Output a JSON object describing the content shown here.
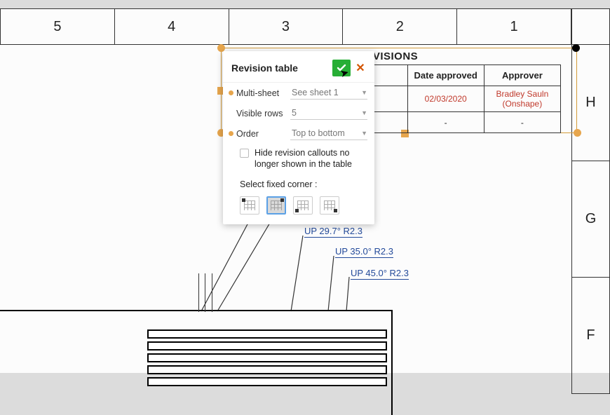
{
  "border": {
    "columns": [
      "5",
      "4",
      "3",
      "2",
      "1"
    ],
    "rows": [
      "H",
      "G",
      "F"
    ]
  },
  "revisions": {
    "title": "REVISIONS",
    "headers": {
      "date": "Date approved",
      "approver": "Approver"
    },
    "row1": {
      "date": "02/03/2020",
      "approver_name": "Bradley Sauln",
      "approver_org": "(Onshape)"
    },
    "row2": {
      "date": "-",
      "approver": "-"
    }
  },
  "popup": {
    "title": "Revision table",
    "labels": {
      "multi_sheet": "Multi-sheet",
      "visible_rows": "Visible rows",
      "order": "Order",
      "hide_callouts": "Hide revision callouts no longer shown in the table",
      "select_corner": "Select fixed corner :"
    },
    "values": {
      "multi_sheet": "See sheet 1",
      "visible_rows": "5",
      "order": "Top to bottom"
    }
  },
  "annotations": {
    "a1": "UP 29.7° R2.3",
    "a2": "UP 35.0° R2.3",
    "a3": "UP 45.0° R2.3"
  }
}
